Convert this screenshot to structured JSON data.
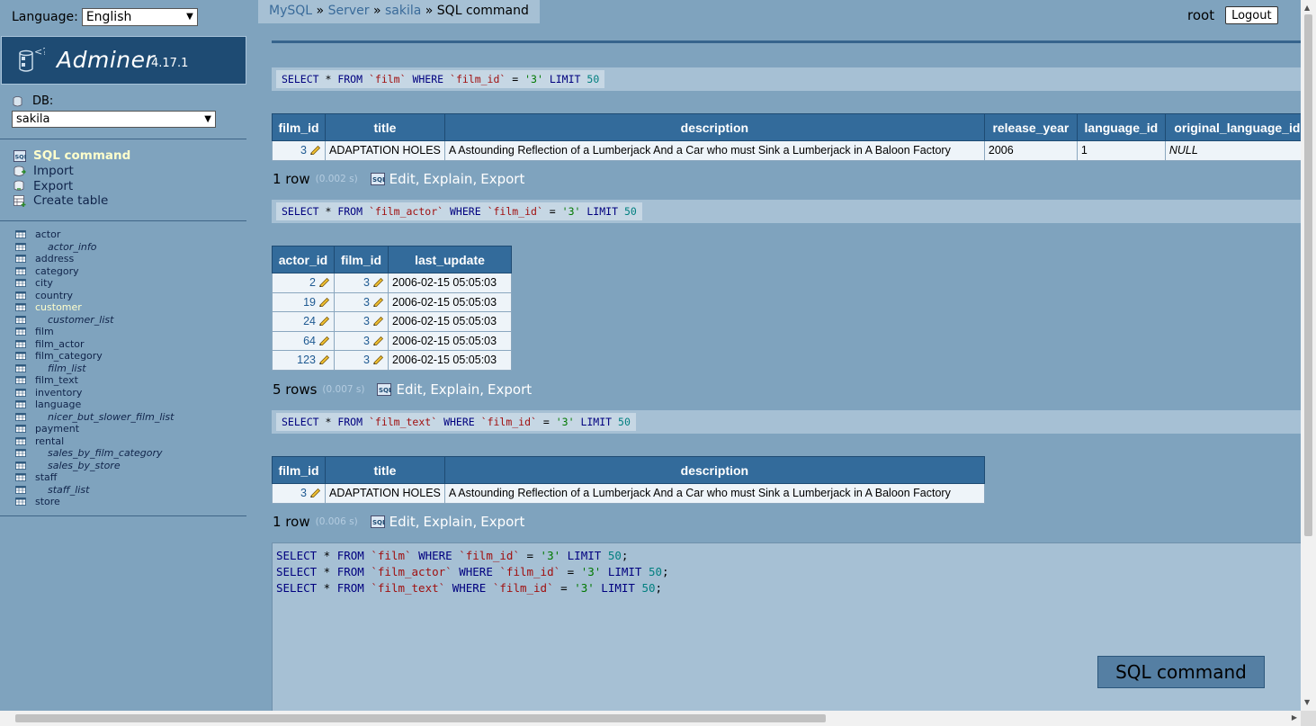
{
  "language": {
    "label": "Language:",
    "selected": "English"
  },
  "app": {
    "name": "Adminer",
    "version": "4.17.1"
  },
  "db": {
    "label": "DB:",
    "selected": "sakila"
  },
  "menu": [
    {
      "label": "SQL command",
      "icon": "sql-icon",
      "active": true
    },
    {
      "label": "Import",
      "icon": "import-icon",
      "active": false
    },
    {
      "label": "Export",
      "icon": "export-icon",
      "active": false
    },
    {
      "label": "Create table",
      "icon": "create-table-icon",
      "active": false
    }
  ],
  "tables": [
    {
      "name": "actor",
      "view": false
    },
    {
      "name": "actor_info",
      "view": true
    },
    {
      "name": "address",
      "view": false
    },
    {
      "name": "category",
      "view": false
    },
    {
      "name": "city",
      "view": false
    },
    {
      "name": "country",
      "view": false
    },
    {
      "name": "customer",
      "view": false,
      "active": true
    },
    {
      "name": "customer_list",
      "view": true
    },
    {
      "name": "film",
      "view": false
    },
    {
      "name": "film_actor",
      "view": false
    },
    {
      "name": "film_category",
      "view": false
    },
    {
      "name": "film_list",
      "view": true
    },
    {
      "name": "film_text",
      "view": false
    },
    {
      "name": "inventory",
      "view": false
    },
    {
      "name": "language",
      "view": false
    },
    {
      "name": "nicer_but_slower_film_list",
      "view": true
    },
    {
      "name": "payment",
      "view": false
    },
    {
      "name": "rental",
      "view": false
    },
    {
      "name": "sales_by_film_category",
      "view": true
    },
    {
      "name": "sales_by_store",
      "view": true
    },
    {
      "name": "staff",
      "view": false
    },
    {
      "name": "staff_list",
      "view": true
    },
    {
      "name": "store",
      "view": false
    }
  ],
  "breadcrumb": {
    "mysql": "MySQL",
    "server": "Server",
    "db": "sakila",
    "current": "SQL command",
    "sep": "»"
  },
  "user": {
    "name": "root",
    "logout": "Logout"
  },
  "queries": [
    {
      "sql": [
        [
          "kw",
          "SELECT"
        ],
        [
          "",
          " * "
        ],
        [
          "kw",
          "FROM"
        ],
        [
          "",
          " "
        ],
        [
          "id",
          "`film`"
        ],
        [
          "",
          " "
        ],
        [
          "kw",
          "WHERE"
        ],
        [
          "",
          " "
        ],
        [
          "id",
          "`film_id`"
        ],
        [
          "",
          " = "
        ],
        [
          "str",
          "'3'"
        ],
        [
          "",
          " "
        ],
        [
          "kw",
          "LIMIT"
        ],
        [
          "",
          " "
        ],
        [
          "num",
          "50"
        ]
      ],
      "columns": [
        "film_id",
        "title",
        "description",
        "release_year",
        "language_id",
        "original_language_id"
      ],
      "rows": [
        [
          "3",
          "ADAPTATION HOLES",
          "A Astounding Reflection of a Lumberjack And a Car who must Sink a Lumberjack in A Baloon Factory",
          "2006",
          "1",
          "NULL"
        ]
      ],
      "count": "1 row",
      "time": "(0.002 s)"
    },
    {
      "sql": [
        [
          "kw",
          "SELECT"
        ],
        [
          "",
          " * "
        ],
        [
          "kw",
          "FROM"
        ],
        [
          "",
          " "
        ],
        [
          "id",
          "`film_actor`"
        ],
        [
          "",
          " "
        ],
        [
          "kw",
          "WHERE"
        ],
        [
          "",
          " "
        ],
        [
          "id",
          "`film_id`"
        ],
        [
          "",
          " = "
        ],
        [
          "str",
          "'3'"
        ],
        [
          "",
          " "
        ],
        [
          "kw",
          "LIMIT"
        ],
        [
          "",
          " "
        ],
        [
          "num",
          "50"
        ]
      ],
      "columns": [
        "actor_id",
        "film_id",
        "last_update"
      ],
      "rows": [
        [
          "2",
          "3",
          "2006-02-15 05:05:03"
        ],
        [
          "19",
          "3",
          "2006-02-15 05:05:03"
        ],
        [
          "24",
          "3",
          "2006-02-15 05:05:03"
        ],
        [
          "64",
          "3",
          "2006-02-15 05:05:03"
        ],
        [
          "123",
          "3",
          "2006-02-15 05:05:03"
        ]
      ],
      "count": "5 rows",
      "time": "(0.007 s)"
    },
    {
      "sql": [
        [
          "kw",
          "SELECT"
        ],
        [
          "",
          " * "
        ],
        [
          "kw",
          "FROM"
        ],
        [
          "",
          " "
        ],
        [
          "id",
          "`film_text`"
        ],
        [
          "",
          " "
        ],
        [
          "kw",
          "WHERE"
        ],
        [
          "",
          " "
        ],
        [
          "id",
          "`film_id`"
        ],
        [
          "",
          " = "
        ],
        [
          "str",
          "'3'"
        ],
        [
          "",
          " "
        ],
        [
          "kw",
          "LIMIT"
        ],
        [
          "",
          " "
        ],
        [
          "num",
          "50"
        ]
      ],
      "columns": [
        "film_id",
        "title",
        "description"
      ],
      "rows": [
        [
          "3",
          "ADAPTATION HOLES",
          "A Astounding Reflection of a Lumberjack And a Car who must Sink a Lumberjack in A Baloon Factory"
        ]
      ],
      "count": "1 row",
      "time": "(0.006 s)"
    }
  ],
  "actions": {
    "edit": "Edit",
    "explain": "Explain",
    "export": "Export",
    "comma": ","
  },
  "editor_lines": [
    [
      [
        "kw",
        "SELECT"
      ],
      [
        "",
        " * "
      ],
      [
        "kw",
        "FROM"
      ],
      [
        "",
        " "
      ],
      [
        "id",
        "`film`"
      ],
      [
        "",
        " "
      ],
      [
        "kw",
        "WHERE"
      ],
      [
        "",
        " "
      ],
      [
        "id",
        "`film_id`"
      ],
      [
        "",
        " = "
      ],
      [
        "str",
        "'3'"
      ],
      [
        "",
        " "
      ],
      [
        "kw",
        "LIMIT"
      ],
      [
        "",
        " "
      ],
      [
        "num",
        "50"
      ],
      [
        "",
        ";"
      ]
    ],
    [
      [
        "kw",
        "SELECT"
      ],
      [
        "",
        " * "
      ],
      [
        "kw",
        "FROM"
      ],
      [
        "",
        " "
      ],
      [
        "id",
        "`film_actor`"
      ],
      [
        "",
        " "
      ],
      [
        "kw",
        "WHERE"
      ],
      [
        "",
        " "
      ],
      [
        "id",
        "`film_id`"
      ],
      [
        "",
        " = "
      ],
      [
        "str",
        "'3'"
      ],
      [
        "",
        " "
      ],
      [
        "kw",
        "LIMIT"
      ],
      [
        "",
        " "
      ],
      [
        "num",
        "50"
      ],
      [
        "",
        ";"
      ]
    ],
    [
      [
        "kw",
        "SELECT"
      ],
      [
        "",
        " * "
      ],
      [
        "kw",
        "FROM"
      ],
      [
        "",
        " "
      ],
      [
        "id",
        "`film_text`"
      ],
      [
        "",
        " "
      ],
      [
        "kw",
        "WHERE"
      ],
      [
        "",
        " "
      ],
      [
        "id",
        "`film_id`"
      ],
      [
        "",
        " = "
      ],
      [
        "str",
        "'3'"
      ],
      [
        "",
        " "
      ],
      [
        "kw",
        "LIMIT"
      ],
      [
        "",
        " "
      ],
      [
        "num",
        "50"
      ],
      [
        "",
        ";"
      ]
    ]
  ],
  "run_button": "SQL command"
}
